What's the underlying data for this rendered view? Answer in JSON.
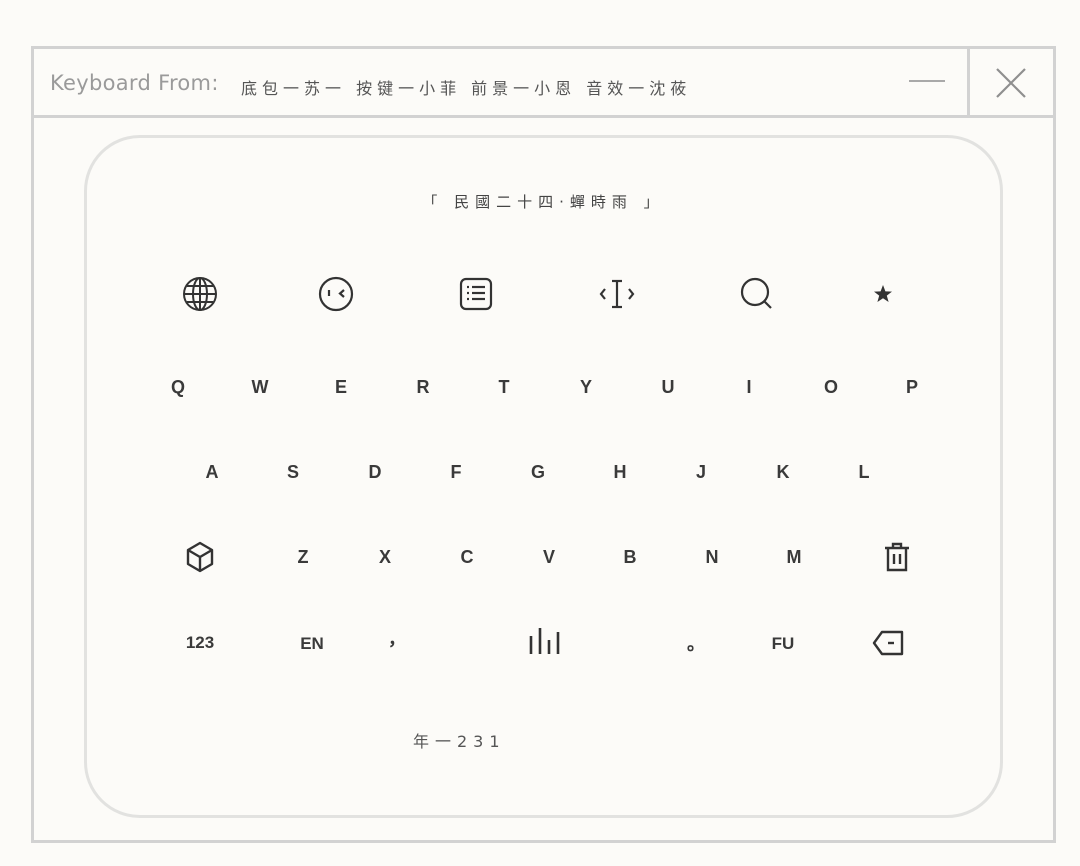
{
  "titlebar": {
    "prefix": "Keyboard From:",
    "credits": "底包一苏一  按键一小菲  前景一小恩  音效一沈莜"
  },
  "panel": {
    "dynasty": "「 民國二十四·蟬時雨 」",
    "footer": "年一231"
  },
  "toolbar_icons": [
    "globe-icon",
    "emoji-face-icon",
    "keyboard-layout-icon",
    "text-cursor-icon",
    "search-icon",
    "star-icon"
  ],
  "rows": {
    "row1": [
      "Q",
      "W",
      "E",
      "R",
      "T",
      "Y",
      "U",
      "I",
      "O",
      "P"
    ],
    "row2": [
      "A",
      "S",
      "D",
      "F",
      "G",
      "H",
      "J",
      "K",
      "L"
    ],
    "row3": [
      "Z",
      "X",
      "C",
      "V",
      "B",
      "N",
      "M"
    ],
    "bottom": {
      "numbers": "123",
      "lang": "EN",
      "comma": "，",
      "period": "。",
      "fu": "FU"
    }
  },
  "icons": {
    "cube": "cube-icon",
    "trash": "trash-icon",
    "voice": "voice-bars-icon",
    "backspace": "backspace-icon"
  }
}
